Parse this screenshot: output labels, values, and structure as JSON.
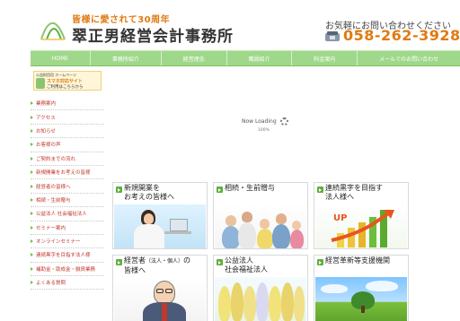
{
  "header": {
    "tagline": "皆様に愛されて30周年",
    "firm_name": "翠正男経営会計事務所",
    "contact_label": "お気軽にお問い合わせください",
    "phone": "058-262-3928"
  },
  "nav": [
    {
      "label": "HOME"
    },
    {
      "label": "事務所紹介"
    },
    {
      "label": "経営理念"
    },
    {
      "label": "職員紹介"
    },
    {
      "label": "料金案内"
    },
    {
      "label": "メールでのお問い合わせ"
    }
  ],
  "sidebar": {
    "banner": {
      "tag": "公益財団用 ホームページ",
      "headline": "スマホ対応サイト",
      "sub": "ご利用はこちらから"
    },
    "items": [
      {
        "label": "業務案内"
      },
      {
        "label": "アクセス"
      },
      {
        "label": "お知らせ"
      },
      {
        "label": "お客様の声"
      },
      {
        "label": "ご契約までの流れ"
      },
      {
        "label": "新規開業をお考えの皆様"
      },
      {
        "label": "経営者の皆様へ"
      },
      {
        "label": "相続・生前贈与"
      },
      {
        "label": "公益法人 社会福祉法人"
      },
      {
        "label": "セミナー案内"
      },
      {
        "label": "オンラインセミナー"
      },
      {
        "label": "連続黒字を目指す法人様"
      },
      {
        "label": "補助金・助成金・融資業務"
      },
      {
        "label": "よくある質問"
      }
    ]
  },
  "slider": {
    "loading_text": "Now Loading",
    "percent": "100%"
  },
  "cards": [
    {
      "line1": "新規開業を",
      "line2": "お考えの皆様へ"
    },
    {
      "line1": "相続・生前贈与",
      "line2": ""
    },
    {
      "line1": "連続黒字を目指す",
      "line2": "法人様へ"
    },
    {
      "line1": "経営者",
      "small": "（法人・個人）",
      "tail": "の",
      "line2": "皆様へ"
    },
    {
      "line1": "公益法人",
      "line2": "社会福祉法人"
    },
    {
      "line1": "経営革新等支援機関",
      "line2": ""
    }
  ],
  "up_label": "UP",
  "colors": {
    "nav_bg": "#9fd88a",
    "accent_orange": "#e07a10",
    "sidebar_link": "#c0392b",
    "card_icon": "#5fae3d"
  }
}
